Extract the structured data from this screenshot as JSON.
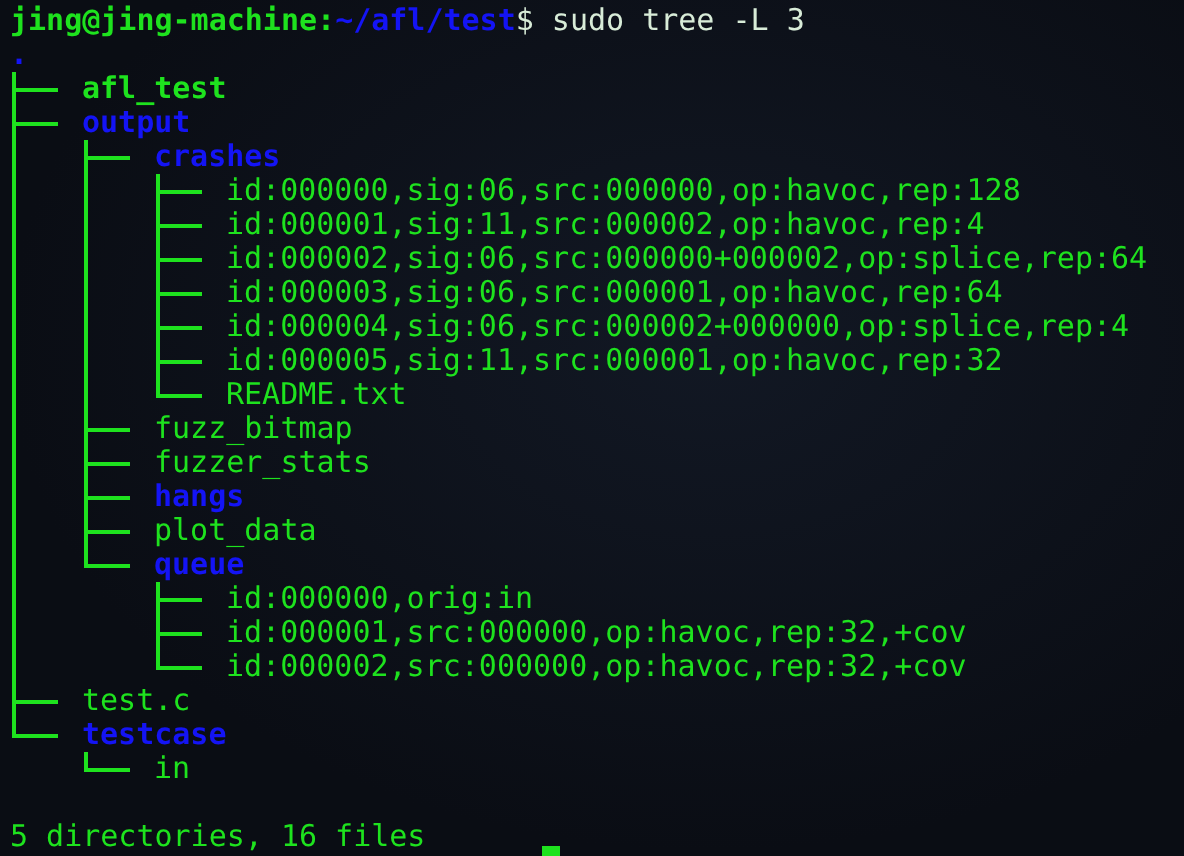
{
  "prompt": {
    "user_host": "jing@jing-machine:",
    "path": "~/afl/test",
    "command": "$ sudo tree -L 3"
  },
  "tree": {
    "name": ".",
    "kind": "directory",
    "children": [
      {
        "name": "afl_test",
        "kind": "executable"
      },
      {
        "name": "output",
        "kind": "directory",
        "children": [
          {
            "name": "crashes",
            "kind": "directory",
            "children": [
              {
                "name": "id:000000,sig:06,src:000000,op:havoc,rep:128",
                "kind": "file"
              },
              {
                "name": "id:000001,sig:11,src:000002,op:havoc,rep:4",
                "kind": "file"
              },
              {
                "name": "id:000002,sig:06,src:000000+000002,op:splice,rep:64",
                "kind": "file"
              },
              {
                "name": "id:000003,sig:06,src:000001,op:havoc,rep:64",
                "kind": "file"
              },
              {
                "name": "id:000004,sig:06,src:000002+000000,op:splice,rep:4",
                "kind": "file"
              },
              {
                "name": "id:000005,sig:11,src:000001,op:havoc,rep:32",
                "kind": "file"
              },
              {
                "name": "README.txt",
                "kind": "file"
              }
            ]
          },
          {
            "name": "fuzz_bitmap",
            "kind": "file"
          },
          {
            "name": "fuzzer_stats",
            "kind": "file"
          },
          {
            "name": "hangs",
            "kind": "directory"
          },
          {
            "name": "plot_data",
            "kind": "file"
          },
          {
            "name": "queue",
            "kind": "directory",
            "children": [
              {
                "name": "id:000000,orig:in",
                "kind": "file"
              },
              {
                "name": "id:000001,src:000000,op:havoc,rep:32,+cov",
                "kind": "file"
              },
              {
                "name": "id:000002,src:000000,op:havoc,rep:32,+cov",
                "kind": "file"
              }
            ]
          }
        ]
      },
      {
        "name": "test.c",
        "kind": "file"
      },
      {
        "name": "testcase",
        "kind": "directory",
        "children": [
          {
            "name": "in",
            "kind": "file"
          }
        ]
      }
    ]
  },
  "summary": "5 directories, 16 files"
}
